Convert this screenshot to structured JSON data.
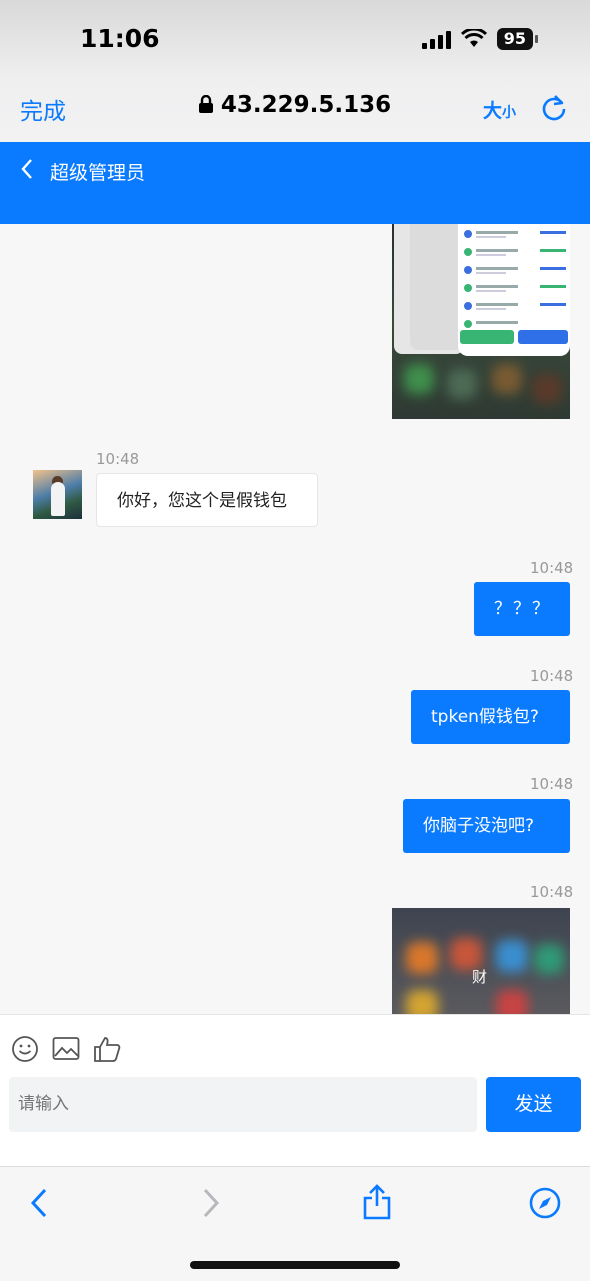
{
  "status_bar": {
    "time": "11:06",
    "battery": "95"
  },
  "safari": {
    "done": "完成",
    "url": "43.229.5.136",
    "text_size": "大",
    "text_size_small": "小"
  },
  "header": {
    "title": "超级管理员"
  },
  "messages": {
    "t1": "10:48",
    "in1": "你好，您这个是假钱包",
    "t2": "10:48",
    "out1": "？？？",
    "t3": "10:48",
    "out2": "tpken假钱包?",
    "t4": "10:48",
    "out3": "你脑子没泡吧?",
    "t5": "10:48",
    "img2_caption": "财"
  },
  "composer": {
    "placeholder": "请输入",
    "send": "发送"
  },
  "icons": {
    "emoji": "emoji-icon",
    "image": "image-icon",
    "like": "thumbs-up-icon",
    "back": "chevron-left-icon",
    "forward": "chevron-right-icon",
    "share": "share-icon",
    "compass": "compass-icon"
  },
  "colors": {
    "accent": "#0a7aff",
    "bubble_in": "#ffffff"
  }
}
